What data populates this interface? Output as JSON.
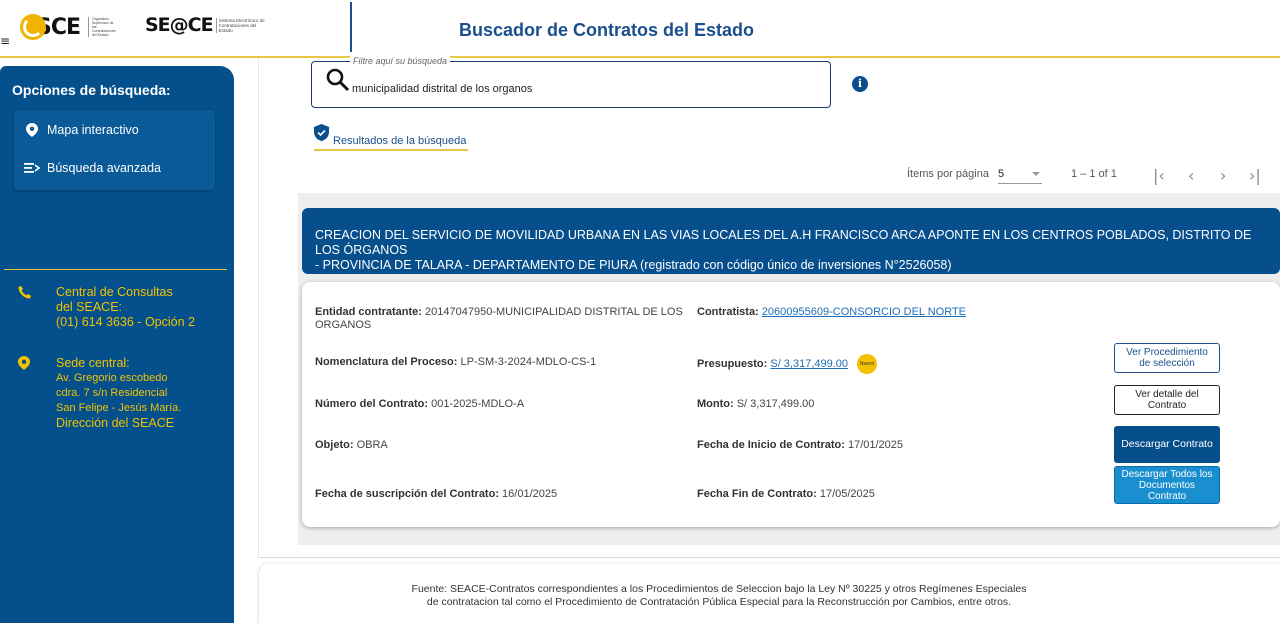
{
  "header": {
    "menu_glyph": "≡",
    "logo_osce": "SCE",
    "logo_osce_sub": "Organismo Supervisor de las Contrataciones del Estado",
    "logo_seace": "SE@CE",
    "logo_seace_sub": "Sistema Electrónico de Contrataciones del Estado",
    "title": "Buscador de Contratos del Estado"
  },
  "sidebar": {
    "title": "Opciones de búsqueda:",
    "items": [
      {
        "label": "Mapa interactivo",
        "icon": "map-pin-icon"
      },
      {
        "label": "Búsqueda avanzada",
        "icon": "advanced-search-icon"
      }
    ],
    "contact": {
      "title_line1": "Central de Consultas",
      "title_line2": "del SEACE:",
      "phone": "(01) 614 3636 - Opción 2"
    },
    "office": {
      "title": "Sede central:",
      "line1": "Av. Gregorio escobedo",
      "line2": "cdra. 7 s/n Residencial",
      "line3": "San Felipe - Jesús María.",
      "bottom": "Dirección del SEACE"
    },
    "accent_color": "#f2c200",
    "bg_color": "#04508c"
  },
  "search": {
    "legend": "Filtre aquí su búsqueda",
    "value": "municipalidad distrital de los organos"
  },
  "results_tab": {
    "label": "Resultados de la búsqueda"
  },
  "paginator": {
    "items_label": "Ítems por página",
    "page_size": "5",
    "range": "1 – 1 of 1",
    "first": "|‹",
    "prev": "‹",
    "next": "›",
    "last": "›|"
  },
  "result": {
    "title_line1": "CREACION DEL SERVICIO DE MOVILIDAD URBANA EN LAS VIAS LOCALES DEL A.H FRANCISCO ARCA APONTE EN LOS CENTROS POBLADOS, DISTRITO DE LOS ÓRGANOS",
    "title_line2": "- PROVINCIA DE TALARA - DEPARTAMENTO DE PIURA (registrado con código único de inversiones N°2526058)",
    "entidad_label": "Entidad contratante:",
    "entidad_value_1": "20147047950-MUNICIPALIDAD DISTRITAL DE LOS",
    "entidad_value_2": "ORGANOS",
    "contratista_label": "Contratista:",
    "contratista_value": "20600955609-CONSORCIO DEL NORTE",
    "nomenclatura_label": "Nomenclatura del Proceso:",
    "nomenclatura_value": "LP-SM-3-2024-MDLO-CS-1",
    "presupuesto_label": "Presupuesto:",
    "presupuesto_value": "S/ 3,317,499.00",
    "nuevo_badge": "Nuevo",
    "numero_label": "Número del Contrato:",
    "numero_value": "001-2025-MDLO-A",
    "monto_label": "Monto:",
    "monto_value": "S/ 3,317,499.00",
    "objeto_label": "Objeto:",
    "objeto_value": "OBRA",
    "inicio_label": "Fecha de Inicio de Contrato:",
    "inicio_value": "17/01/2025",
    "suscripcion_label": "Fecha de suscripción del Contrato:",
    "suscripcion_value": "16/01/2025",
    "fin_label": "Fecha Fin de Contrato:",
    "fin_value": "17/05/2025",
    "btn_procedimiento_1": "Ver Procedimiento",
    "btn_procedimiento_2": "de selección",
    "btn_detalle_1": "Ver detalle del",
    "btn_detalle_2": "Contrato",
    "btn_descargar": "Descargar Contrato",
    "btn_todos_1": "Descargar Todos los",
    "btn_todos_2": "Documentos",
    "btn_todos_3": "Contrato"
  },
  "footer": {
    "line1": "Fuente: SEACE-Contratos correspondientes a los Procedimientos de Seleccion bajo la Ley Nº 30225 y otros Regímenes Especiales",
    "line2": "de contratacion tal como el Procedimiento de Contratación Pública Especial para la Reconstrucción por Cambios, entre otros."
  }
}
